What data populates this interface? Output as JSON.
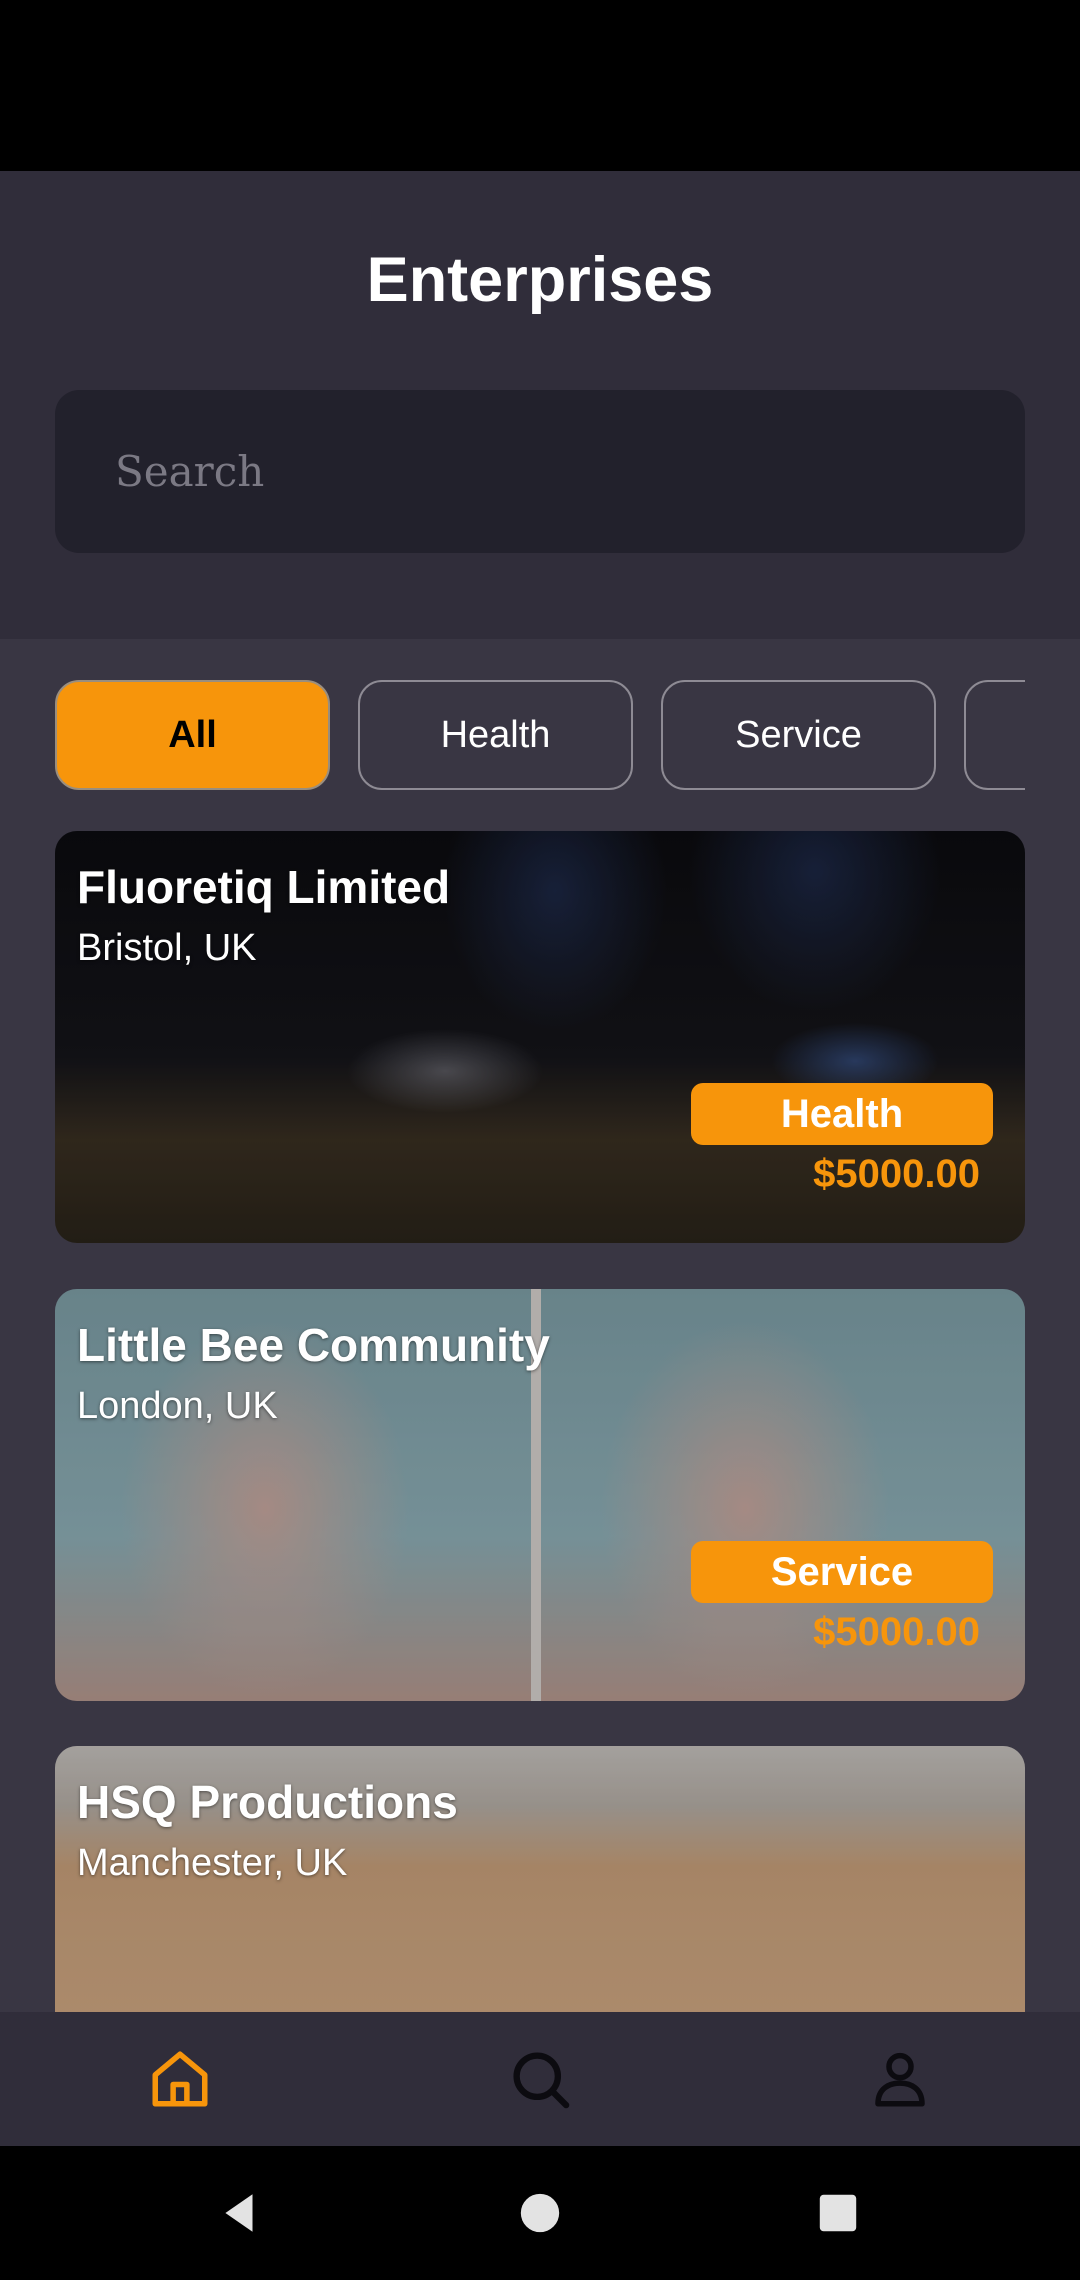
{
  "header": {
    "title": "Enterprises",
    "search_placeholder": "Search"
  },
  "filters": [
    {
      "label": "All",
      "active": true
    },
    {
      "label": "Health",
      "active": false
    },
    {
      "label": "Service",
      "active": false
    },
    {
      "label": "",
      "active": false
    }
  ],
  "enterprises": [
    {
      "name": "Fluoretiq Limited",
      "city": "Bristol, UK",
      "category": "Health",
      "price": "$5000.00"
    },
    {
      "name": "Little Bee Community",
      "city": "London, UK",
      "category": "Service",
      "price": "$5000.00"
    },
    {
      "name": "HSQ Productions",
      "city": "Manchester, UK"
    }
  ],
  "bottom_nav": [
    {
      "icon": "home-icon",
      "active": true
    },
    {
      "icon": "search-icon",
      "active": false
    },
    {
      "icon": "user-icon",
      "active": false
    }
  ],
  "system_nav": [
    "back-icon",
    "home-circle-icon",
    "recents-icon"
  ],
  "colors": {
    "accent": "#f7950b",
    "header_bg": "#302d3a",
    "content_bg": "#393643",
    "search_bg": "#22212c"
  }
}
